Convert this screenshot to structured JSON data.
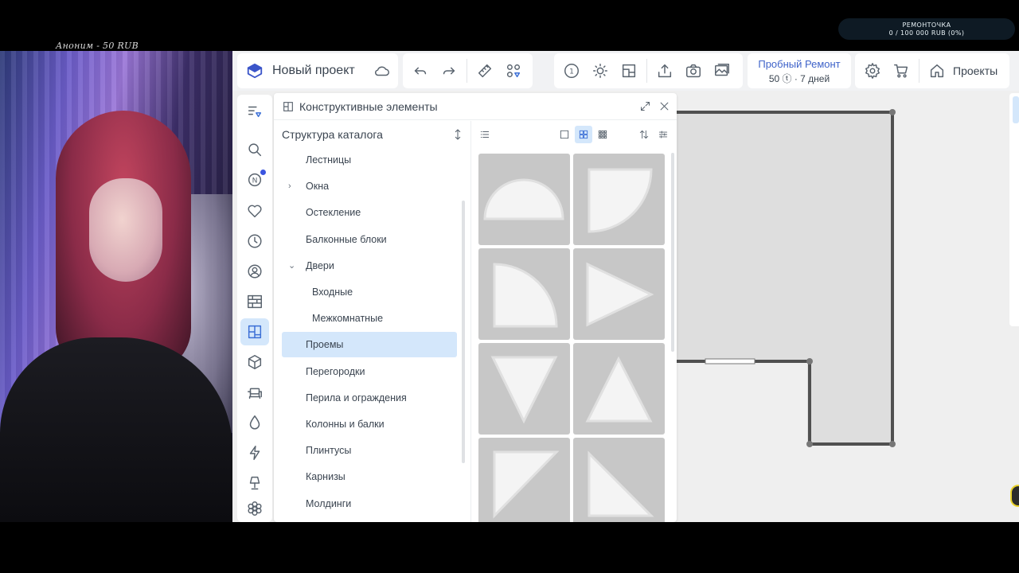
{
  "overlay": {
    "donation": "Аноним - 50 RUB",
    "goal_title": "РЕМОНТОЧКА",
    "goal_progress": "0 / 100 000 RUB (0%)"
  },
  "topbar": {
    "project_title": "Новый проект",
    "trial_title": "Пробный Ремонт",
    "trial_detail": "50 ⓣ · 7 дней",
    "projects_label": "Проекты",
    "floor_number": "1"
  },
  "panel": {
    "title": "Конструктивные элементы",
    "tree_header": "Структура каталога",
    "tree": [
      {
        "label": "Лестницы",
        "indent": 0,
        "chevron": ""
      },
      {
        "label": "Окна",
        "indent": 0,
        "chevron": "›"
      },
      {
        "label": "Остекление",
        "indent": 0,
        "chevron": ""
      },
      {
        "label": "Балконные блоки",
        "indent": 0,
        "chevron": ""
      },
      {
        "label": "Двери",
        "indent": 0,
        "chevron": "⌄"
      },
      {
        "label": "Входные",
        "indent": 1,
        "chevron": ""
      },
      {
        "label": "Межкомнатные",
        "indent": 1,
        "chevron": ""
      },
      {
        "label": "Проемы",
        "indent": 0,
        "chevron": "",
        "selected": true
      },
      {
        "label": "Перегородки",
        "indent": 0,
        "chevron": ""
      },
      {
        "label": "Перила и ограждения",
        "indent": 0,
        "chevron": ""
      },
      {
        "label": "Колонны и балки",
        "indent": 0,
        "chevron": ""
      },
      {
        "label": "Плинтусы",
        "indent": 0,
        "chevron": ""
      },
      {
        "label": "Карнизы",
        "indent": 0,
        "chevron": ""
      },
      {
        "label": "Молдинги",
        "indent": 0,
        "chevron": ""
      }
    ],
    "tiles": [
      "half-circle-opening",
      "quarter-circle-opening",
      "quarter-circle-opening-left",
      "triangle-right-opening",
      "triangle-down-opening",
      "triangle-up-opening",
      "right-triangle-opening",
      "right-triangle-opening-alt"
    ]
  },
  "colors": {
    "accent": "#3b6fd6",
    "selection": "#d4e7fb",
    "wall": "#505050",
    "room_fill": "#dedede"
  }
}
